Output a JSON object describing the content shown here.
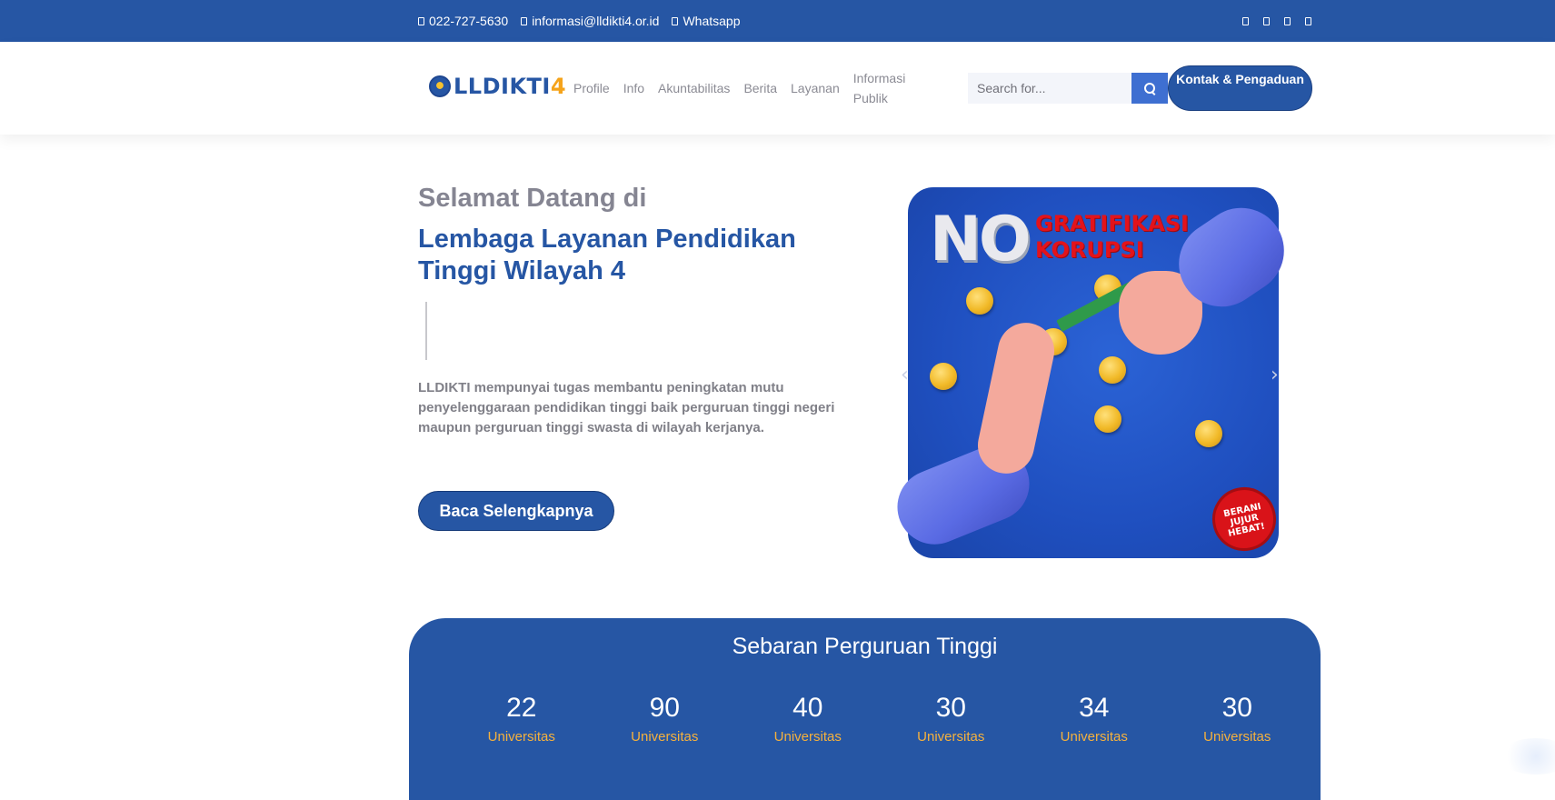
{
  "topbar": {
    "phone": "022-727-5630",
    "email": "informasi@lldikti4.or.id",
    "whatsapp": "Whatsapp",
    "social_icons": [
      "facebook-icon",
      "twitter-icon",
      "instagram-icon",
      "youtube-icon"
    ]
  },
  "header": {
    "logo_text": "LLDIKTI",
    "logo_number": "4",
    "nav": [
      {
        "label": "Profile"
      },
      {
        "label": "Info"
      },
      {
        "label": "Akuntabilitas"
      },
      {
        "label": "Berita"
      },
      {
        "label": "Layanan"
      },
      {
        "label": "Informasi Publik"
      }
    ],
    "search_placeholder": "Search for...",
    "contact_button": "Kontak & Pengaduan"
  },
  "hero": {
    "pretitle": "Selamat Datang di",
    "title": "Lembaga Layanan Pendidikan Tinggi Wilayah 4",
    "description": "LLDIKTI mempunyai tugas membantu peningkatan mutu penyelenggaraan pendidikan tinggi baik perguruan tinggi negeri maupun perguruan tinggi swasta di wilayah kerjanya.",
    "button": "Baca Selengkapnya"
  },
  "slider": {
    "headline": "NO",
    "subline_1": "GRATIFIKASI",
    "subline_2": "KORUPSI",
    "badge": "BERANI JUJUR HEBAT!",
    "prev_arrow": "‹",
    "next_arrow": "›"
  },
  "stats": {
    "title": "Sebaran Perguruan Tinggi",
    "items": [
      {
        "value": "22",
        "label": "Universitas"
      },
      {
        "value": "90",
        "label": "Universitas"
      },
      {
        "value": "40",
        "label": "Universitas"
      },
      {
        "value": "30",
        "label": "Universitas"
      },
      {
        "value": "34",
        "label": "Universitas"
      },
      {
        "value": "30",
        "label": "Universitas"
      }
    ]
  },
  "colors": {
    "primary": "#2656a4",
    "accent": "#f5b13d",
    "search_button": "#3e6fd1",
    "badge_red": "#d91319"
  }
}
